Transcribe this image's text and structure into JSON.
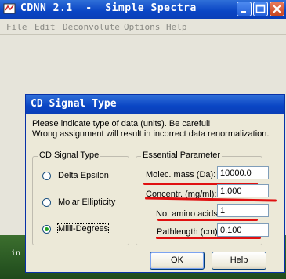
{
  "window": {
    "title": "CDNN 2.1  -  Simple Spectra",
    "controls": [
      "minimize-icon",
      "maximize-icon",
      "close-icon"
    ]
  },
  "menubar": {
    "items": [
      "File",
      "Edit",
      "Deconvolute",
      "Options",
      "Help"
    ]
  },
  "desktop": {
    "text": "in"
  },
  "dialog": {
    "title": "CD Signal Type",
    "message_line1": "Please indicate type of data (units). Be careful!",
    "message_line2": "Wrong assignment will result in incorrect data renormalization.",
    "signal_group": {
      "label": "CD Signal Type",
      "options": [
        "Delta Epsilon",
        "Molar Ellipticity",
        "Milli-Degrees"
      ],
      "selected": "Milli-Degrees"
    },
    "params_group": {
      "label": "Essential Parameter",
      "fields": [
        {
          "label": "Molec. mass (Da):",
          "value": "10000.0"
        },
        {
          "label": "Concentr. (mg/ml):",
          "value": "1.000"
        },
        {
          "label": "No. amino acids:",
          "value": "1"
        },
        {
          "label": "Pathlength (cm):",
          "value": "0.100"
        }
      ]
    },
    "buttons": {
      "ok": "OK",
      "help": "Help"
    }
  },
  "colors": {
    "titlebar": "#0a45c4",
    "dialog_bg": "#ece9d8",
    "annotation_red": "#e01010"
  }
}
